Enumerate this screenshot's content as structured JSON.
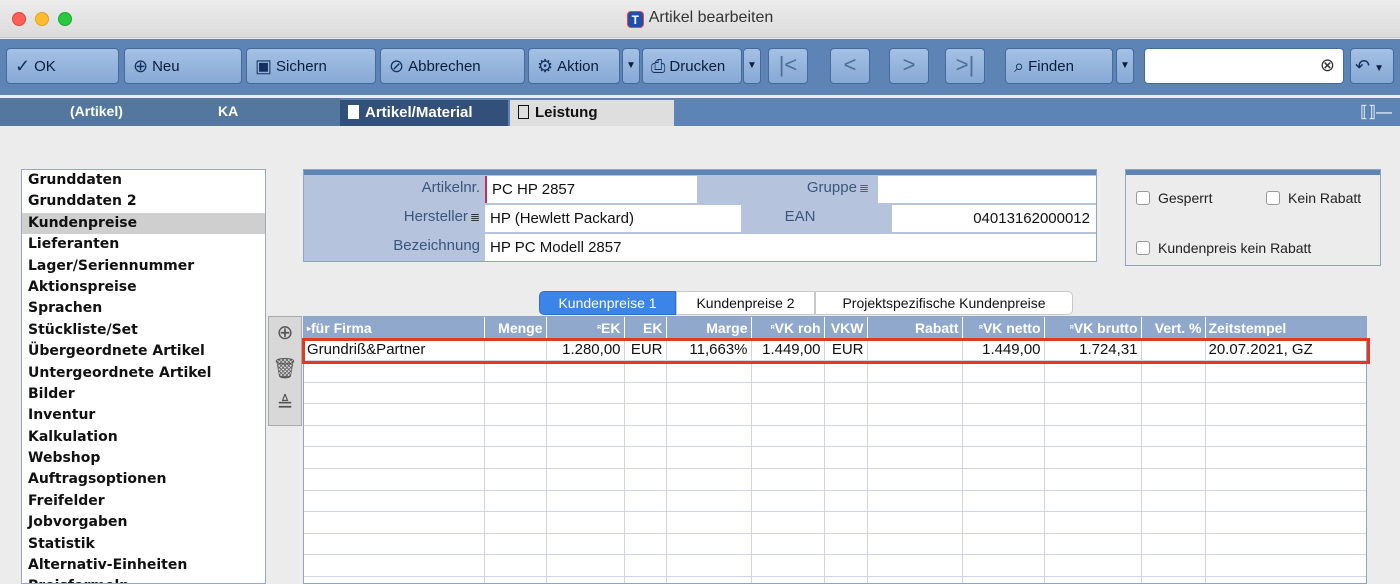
{
  "window": {
    "title": "Artikel bearbeiten",
    "app_icon": "T"
  },
  "toolbar": {
    "ok": "OK",
    "new": "Neu",
    "save": "Sichern",
    "cancel": "Abbrechen",
    "action": "Aktion",
    "print": "Drucken",
    "find": "Finden",
    "search_value": ""
  },
  "tabstrip": {
    "context_label": "(Artikel)",
    "context_code": "KA",
    "tab_active": "Artikel/Material",
    "tab_other": "Leistung"
  },
  "sidebar": {
    "items": [
      "Grunddaten",
      "Grunddaten 2",
      "Kundenpreise",
      "Lieferanten",
      "Lager/Seriennummer",
      "Aktionspreise",
      "Sprachen",
      "Stückliste/Set",
      "Übergeordnete Artikel",
      "Untergeordnete Artikel",
      "Bilder",
      "Inventur",
      "Kalkulation",
      "Webshop",
      "Auftragsoptionen",
      "Freifelder",
      "Jobvorgaben",
      "Statistik",
      "Alternativ-Einheiten",
      "Preisformeln"
    ],
    "selected": "Kundenpreise"
  },
  "form": {
    "artikelnr_label": "Artikelnr.",
    "artikelnr_value": "PC HP 2857",
    "gruppe_label": "Gruppe",
    "gruppe_value": "",
    "hersteller_label": "Hersteller",
    "hersteller_value": "HP (Hewlett Packard)",
    "ean_label": "EAN",
    "ean_value": "04013162000012",
    "bezeichnung_label": "Bezeichnung",
    "bezeichnung_value": "HP PC Modell 2857"
  },
  "flags": {
    "gesperrt": "Gesperrt",
    "kein_rabatt": "Kein Rabatt",
    "kundenpreis_kein_rabatt": "Kundenpreis kein Rabatt"
  },
  "subtabs": [
    "Kundenpreise 1",
    "Kundenpreise 2",
    "Projektspezifische Kundenpreise"
  ],
  "table": {
    "headers": [
      "für Firma",
      "Menge",
      "EK",
      "EK",
      "Marge",
      "VK roh",
      "VKW",
      "Rabatt",
      "VK netto",
      "VK brutto",
      "Vert. %",
      "Zeitstempel"
    ],
    "rows": [
      [
        "Grundriß&Partner",
        "",
        "1.280,00",
        "EUR",
        "11,663%",
        "1.449,00",
        "EUR",
        "",
        "1.449,00",
        "1.724,31",
        "",
        "20.07.2021, GZ"
      ]
    ]
  },
  "colors": {
    "toolbar_bg": "#5e83b5",
    "highlight": "#e23a22",
    "selected_tab": "#3b84e8"
  }
}
